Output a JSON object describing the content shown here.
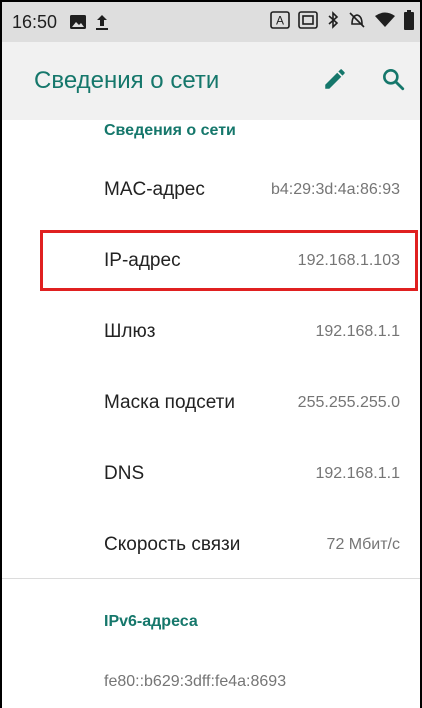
{
  "status_bar": {
    "time": "16:50",
    "left_icons": [
      "image-icon",
      "upload-icon"
    ],
    "right_icons": [
      "keyboard-a-icon",
      "screenshot-icon",
      "bluetooth-icon",
      "do-not-disturb-icon",
      "wifi-icon",
      "battery-icon"
    ]
  },
  "app_bar": {
    "title": "Сведения о сети",
    "actions": [
      "edit-icon",
      "search-icon"
    ],
    "accent_color": "#15776b"
  },
  "network_section": {
    "header": "Сведения о сети",
    "rows": [
      {
        "label": "MAC-адрес",
        "value": "b4:29:3d:4a:86:93"
      },
      {
        "label": "IP-адрес",
        "value": "192.168.1.103",
        "highlighted": true
      },
      {
        "label": "Шлюз",
        "value": "192.168.1.1"
      },
      {
        "label": "Маска подсети",
        "value": "255.255.255.0"
      },
      {
        "label": "DNS",
        "value": "192.168.1.1"
      },
      {
        "label": "Скорость связи",
        "value": "72 Мбит/с"
      }
    ]
  },
  "ipv6_section": {
    "header": "IPv6-адреса",
    "address": "fe80::b629:3dff:fe4a:8693"
  },
  "highlight_color": "#e02020"
}
